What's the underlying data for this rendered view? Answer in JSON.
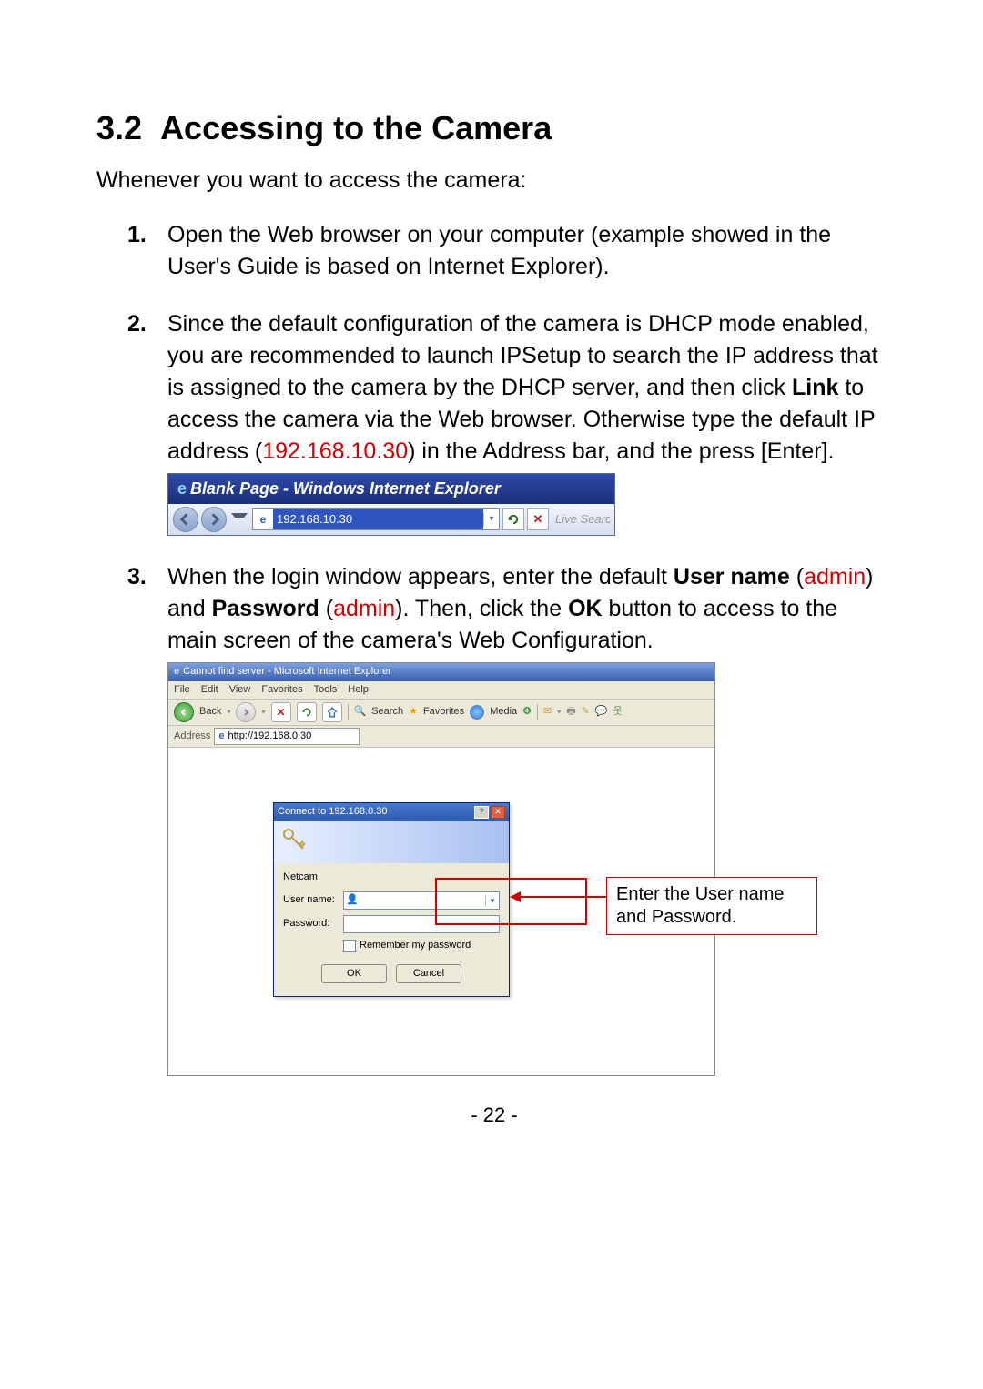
{
  "section": {
    "number": "3.2",
    "title": "Accessing to the Camera"
  },
  "intro": "Whenever you want to access the camera:",
  "steps": {
    "s1": {
      "num": "1.",
      "text": "Open the Web browser on your computer (example showed in the User's Guide is based on Internet Explorer)."
    },
    "s2": {
      "num": "2.",
      "text_a": "Since the default configuration of the camera is DHCP mode enabled, you are recommended to launch IPSetup to search the IP address that is assigned to the camera by the DHCP server, and then click ",
      "bold1": "Link",
      "text_b": " to access the camera via the Web browser.  Otherwise type the default IP address (",
      "ip": "192.168.10.30",
      "text_c": ") in the Address bar, and the press [Enter]."
    },
    "s3": {
      "num": "3.",
      "text_a": "When the login window appears, enter the default ",
      "bold1": "User name",
      "text_b": " (",
      "red1": "admin",
      "text_c": ") and ",
      "bold2": "Password",
      "text_d": " (",
      "red2": "admin",
      "text_e": "). Then, click the ",
      "bold3": "OK",
      "text_f": " button to access to the main screen of the camera's Web Configuration."
    }
  },
  "iebar": {
    "title": "Blank Page - Windows Internet Explorer",
    "address": "192.168.10.30",
    "search_placeholder": "Live Search"
  },
  "ie6": {
    "title": "Cannot find server - Microsoft Internet Explorer",
    "menu": {
      "file": "File",
      "edit": "Edit",
      "view": "View",
      "favorites": "Favorites",
      "tools": "Tools",
      "help": "Help"
    },
    "toolbar": {
      "back": "Back",
      "search": "Search",
      "favorites": "Favorites",
      "media": "Media"
    },
    "address_label": "Address",
    "address_value": "http://192.168.0.30"
  },
  "login": {
    "title": "Connect to 192.168.0.30",
    "realm": "Netcam",
    "user_label": "User name:",
    "pass_label": "Password:",
    "remember": "Remember my password",
    "ok": "OK",
    "cancel": "Cancel"
  },
  "callout": {
    "line1": "Enter the User name",
    "line2": "and Password."
  },
  "page_number": "- 22 -"
}
